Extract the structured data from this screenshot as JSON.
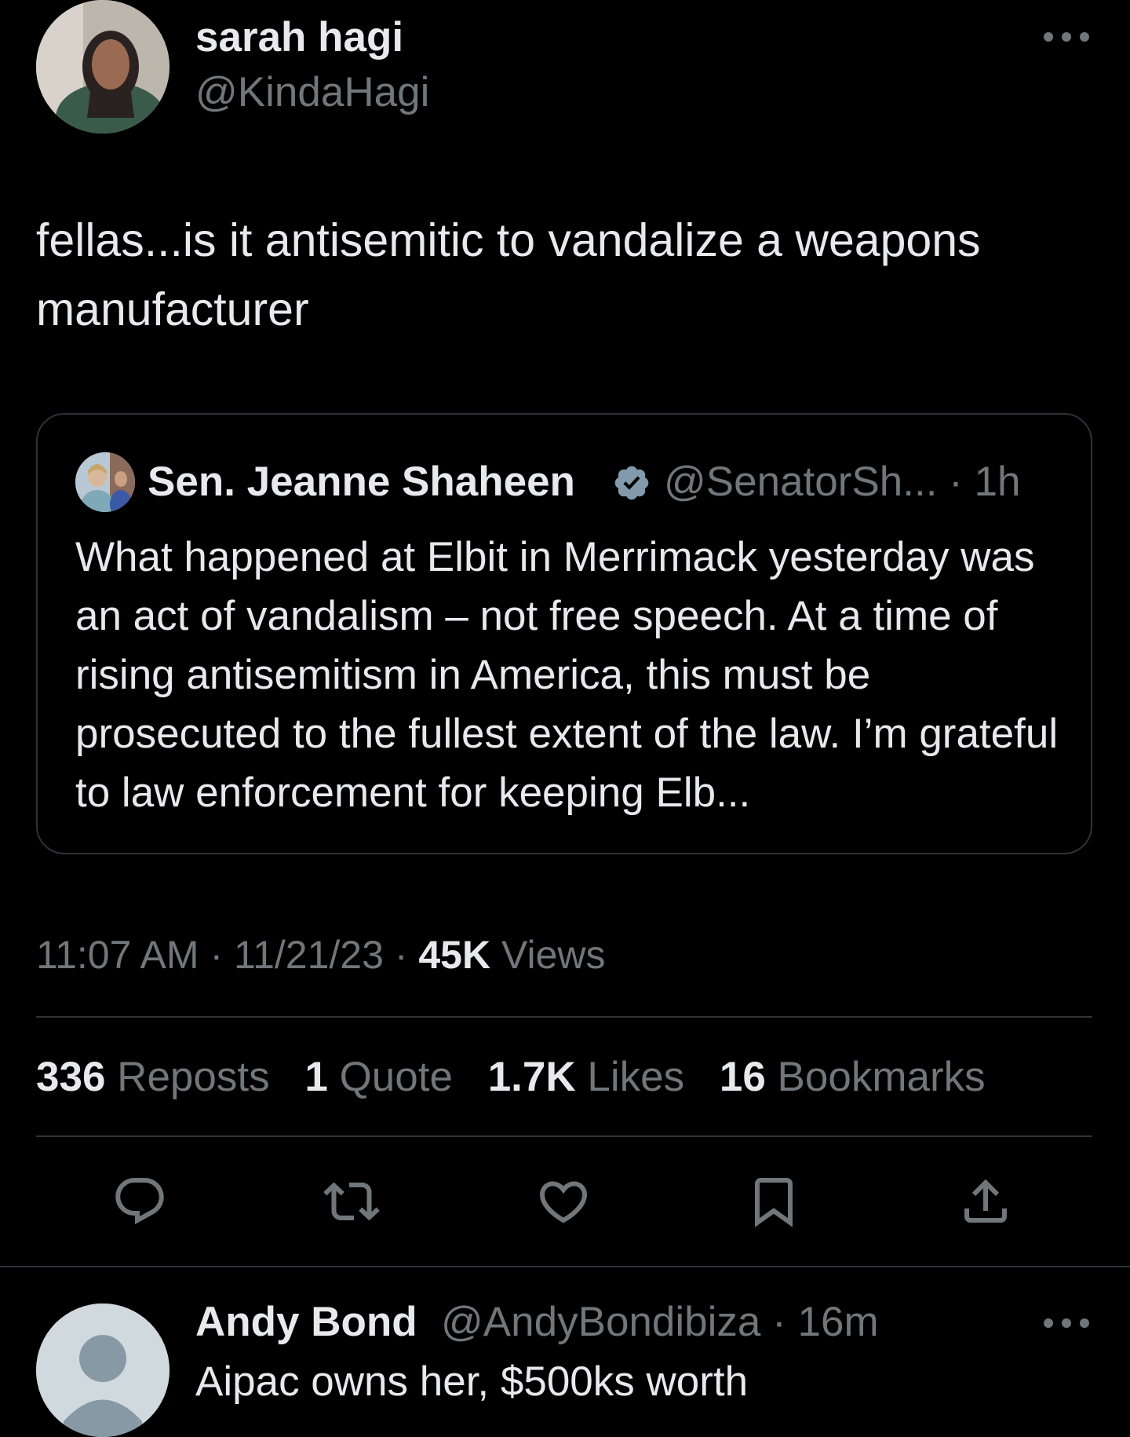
{
  "tweet": {
    "author": {
      "display_name": "sarah hagi",
      "handle": "@KindaHagi"
    },
    "text": "fellas...is it antisemitic to vandalize a weapons manufacturer",
    "quote": {
      "display_name": "Sen. Jeanne Shaheen",
      "handle_meta": "@SenatorSh... · 1h",
      "text": "What happened at Elbit in Merrimack yesterday was an act of vandalism – not free speech. At a time of rising antisemitism in America, this must be prosecuted to the fullest extent of the law. I’m grateful to law enforcement for keeping Elb..."
    },
    "timestamp": {
      "time": "11:07 AM",
      "date": "11/21/23",
      "views_count": "45K",
      "views_label": "Views"
    },
    "stats": {
      "reposts_count": "336",
      "reposts_label": "Reposts",
      "quotes_count": "1",
      "quotes_label": "Quote",
      "likes_count": "1.7K",
      "likes_label": "Likes",
      "bookmarks_count": "16",
      "bookmarks_label": "Bookmarks"
    },
    "actions": [
      "reply-icon",
      "repost-icon",
      "like-icon",
      "bookmark-icon",
      "share-icon"
    ]
  },
  "reply": {
    "display_name": "Andy Bond",
    "handle_meta": "@AndyBondibiza · 16m",
    "text": "Aipac owns her, $500ks worth"
  },
  "colors": {
    "background": "#000000",
    "primary_text": "#e7e9ea",
    "secondary_text": "#71767b",
    "border": "#2f3336",
    "verified_badge": "#829aab"
  }
}
